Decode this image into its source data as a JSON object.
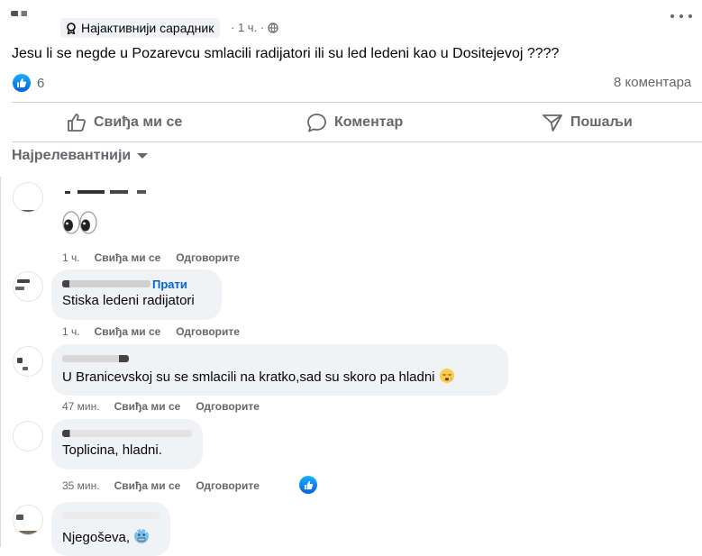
{
  "post": {
    "badge_label": "Најактивнији сарадник",
    "time": "· 1 ч. ·",
    "text": "Jesu li se negde u Pozarevcu smlacili radijatori ili su led ledeni kao u Dositejevoj ????",
    "reactions_count": "6",
    "comments_count": "8 коментара"
  },
  "actions": {
    "like": "Свиђа ми се",
    "comment": "Коментар",
    "share": "Пошаљи"
  },
  "sort_label": "Најрелевантнији",
  "comments": [
    {
      "name": "",
      "follow": "",
      "text": "",
      "time": "1 ч.",
      "like": "Свиђа ми се",
      "reply": "Одговорите"
    },
    {
      "name": "",
      "follow": "Прати",
      "text": "Stiska ledeni radijatori",
      "time": "1 ч.",
      "like": "Свиђа ми се",
      "reply": "Одговорите"
    },
    {
      "name": "",
      "follow": "",
      "text": "U Branicevskoj su se smlacili na kratko,sad su skoro pa hladni",
      "time": "47 мин.",
      "like": "Свиђа ми се",
      "reply": "Одговорите"
    },
    {
      "name": "",
      "follow": "",
      "text": "Toplicina, hladni.",
      "time": "35 мин.",
      "like": "Свиђа ми се",
      "reply": "Одговорите"
    },
    {
      "name": "",
      "follow": "",
      "text": "Njegoševa,",
      "time": "",
      "like": "",
      "reply": ""
    }
  ],
  "icons": {
    "badge": "badge-icon",
    "globe": "globe-icon",
    "more": "more-icon",
    "like_reaction": "like-reaction-icon",
    "like": "thumbs-up-icon",
    "comment": "comment-bubble-icon",
    "share": "share-icon",
    "caret": "caret-down-icon",
    "eyes": "eyes-emoji",
    "sleepy": "sleepy-face-emoji",
    "cold": "cold-face-emoji"
  },
  "colors": {
    "link_blue": "#0064d1",
    "meta_gray": "#65676b",
    "bubble_bg": "#f0f2f5",
    "reaction_blue": "#1877f2"
  }
}
